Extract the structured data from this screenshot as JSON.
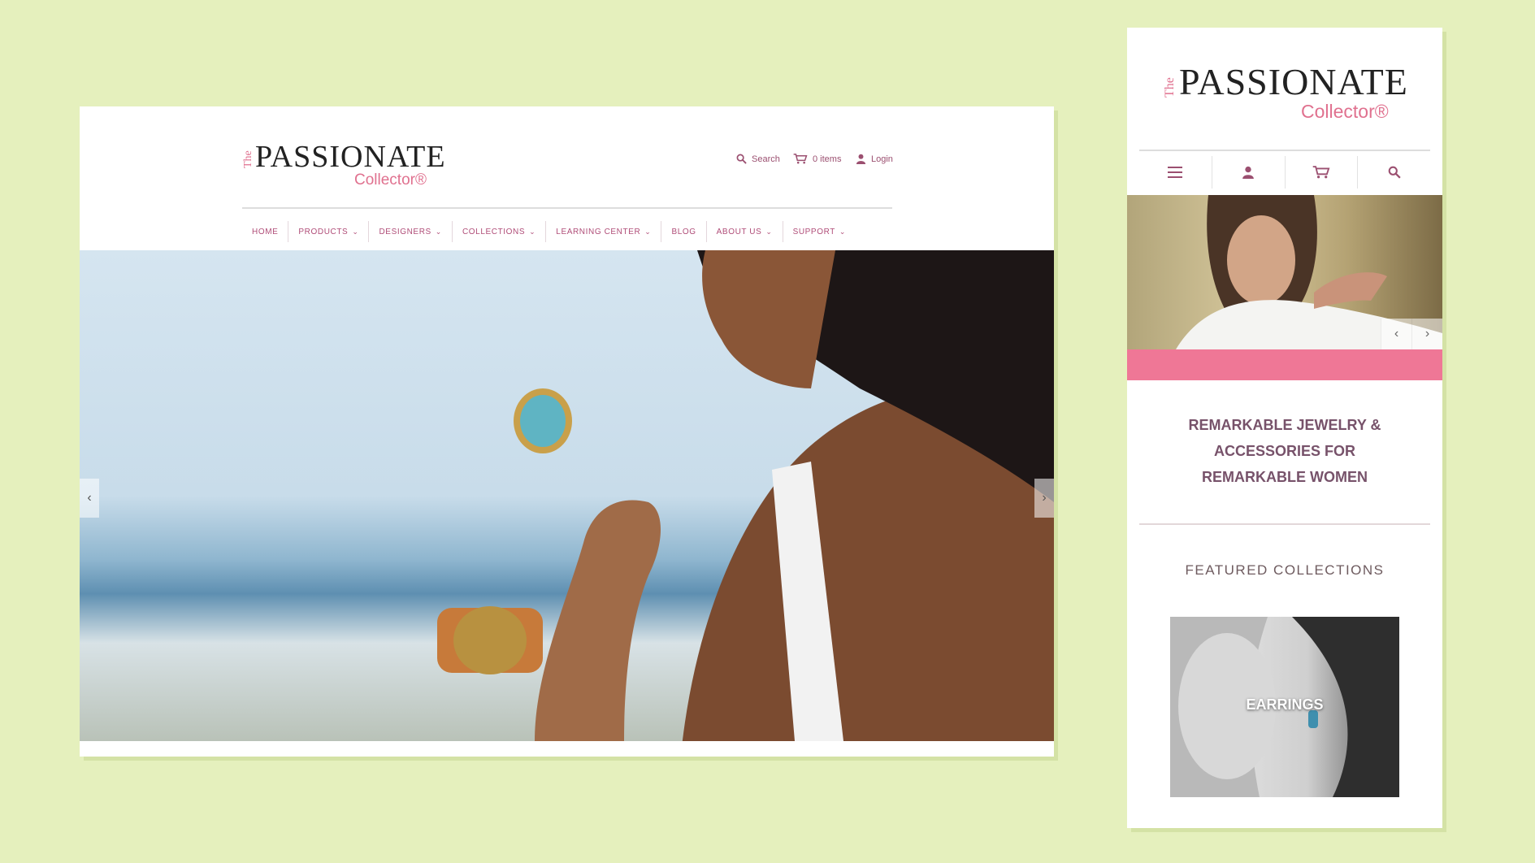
{
  "brand": {
    "the": "The",
    "name": "PASSIONATE",
    "sub": "Collector®"
  },
  "desktop": {
    "utility": {
      "search_label": "Search",
      "cart_label": "0 items",
      "login_label": "Login"
    },
    "nav": [
      {
        "label": "HOME",
        "dropdown": false
      },
      {
        "label": "PRODUCTS",
        "dropdown": true
      },
      {
        "label": "DESIGNERS",
        "dropdown": true
      },
      {
        "label": "COLLECTIONS",
        "dropdown": true
      },
      {
        "label": "LEARNING CENTER",
        "dropdown": true
      },
      {
        "label": "BLOG",
        "dropdown": false
      },
      {
        "label": "ABOUT US",
        "dropdown": true
      },
      {
        "label": "SUPPORT",
        "dropdown": true
      }
    ],
    "chevron": "⌄",
    "prev": "‹",
    "next": "›"
  },
  "mobile": {
    "prev": "‹",
    "next": "›",
    "tagline": [
      "REMARKABLE JEWELRY &",
      "ACCESSORIES FOR",
      "REMARKABLE WOMEN"
    ],
    "featured_heading": "FEATURED COLLECTIONS",
    "featured_card_label": "EARRINGS"
  },
  "colors": {
    "background": "#e5f0bd",
    "accent_pink": "#ef7796",
    "nav_text": "#b04d78",
    "tagline": "#77526a"
  },
  "icons": [
    "search-icon",
    "cart-icon",
    "user-icon",
    "menu-icon",
    "chevron-down-icon",
    "arrow-left-icon",
    "arrow-right-icon"
  ]
}
